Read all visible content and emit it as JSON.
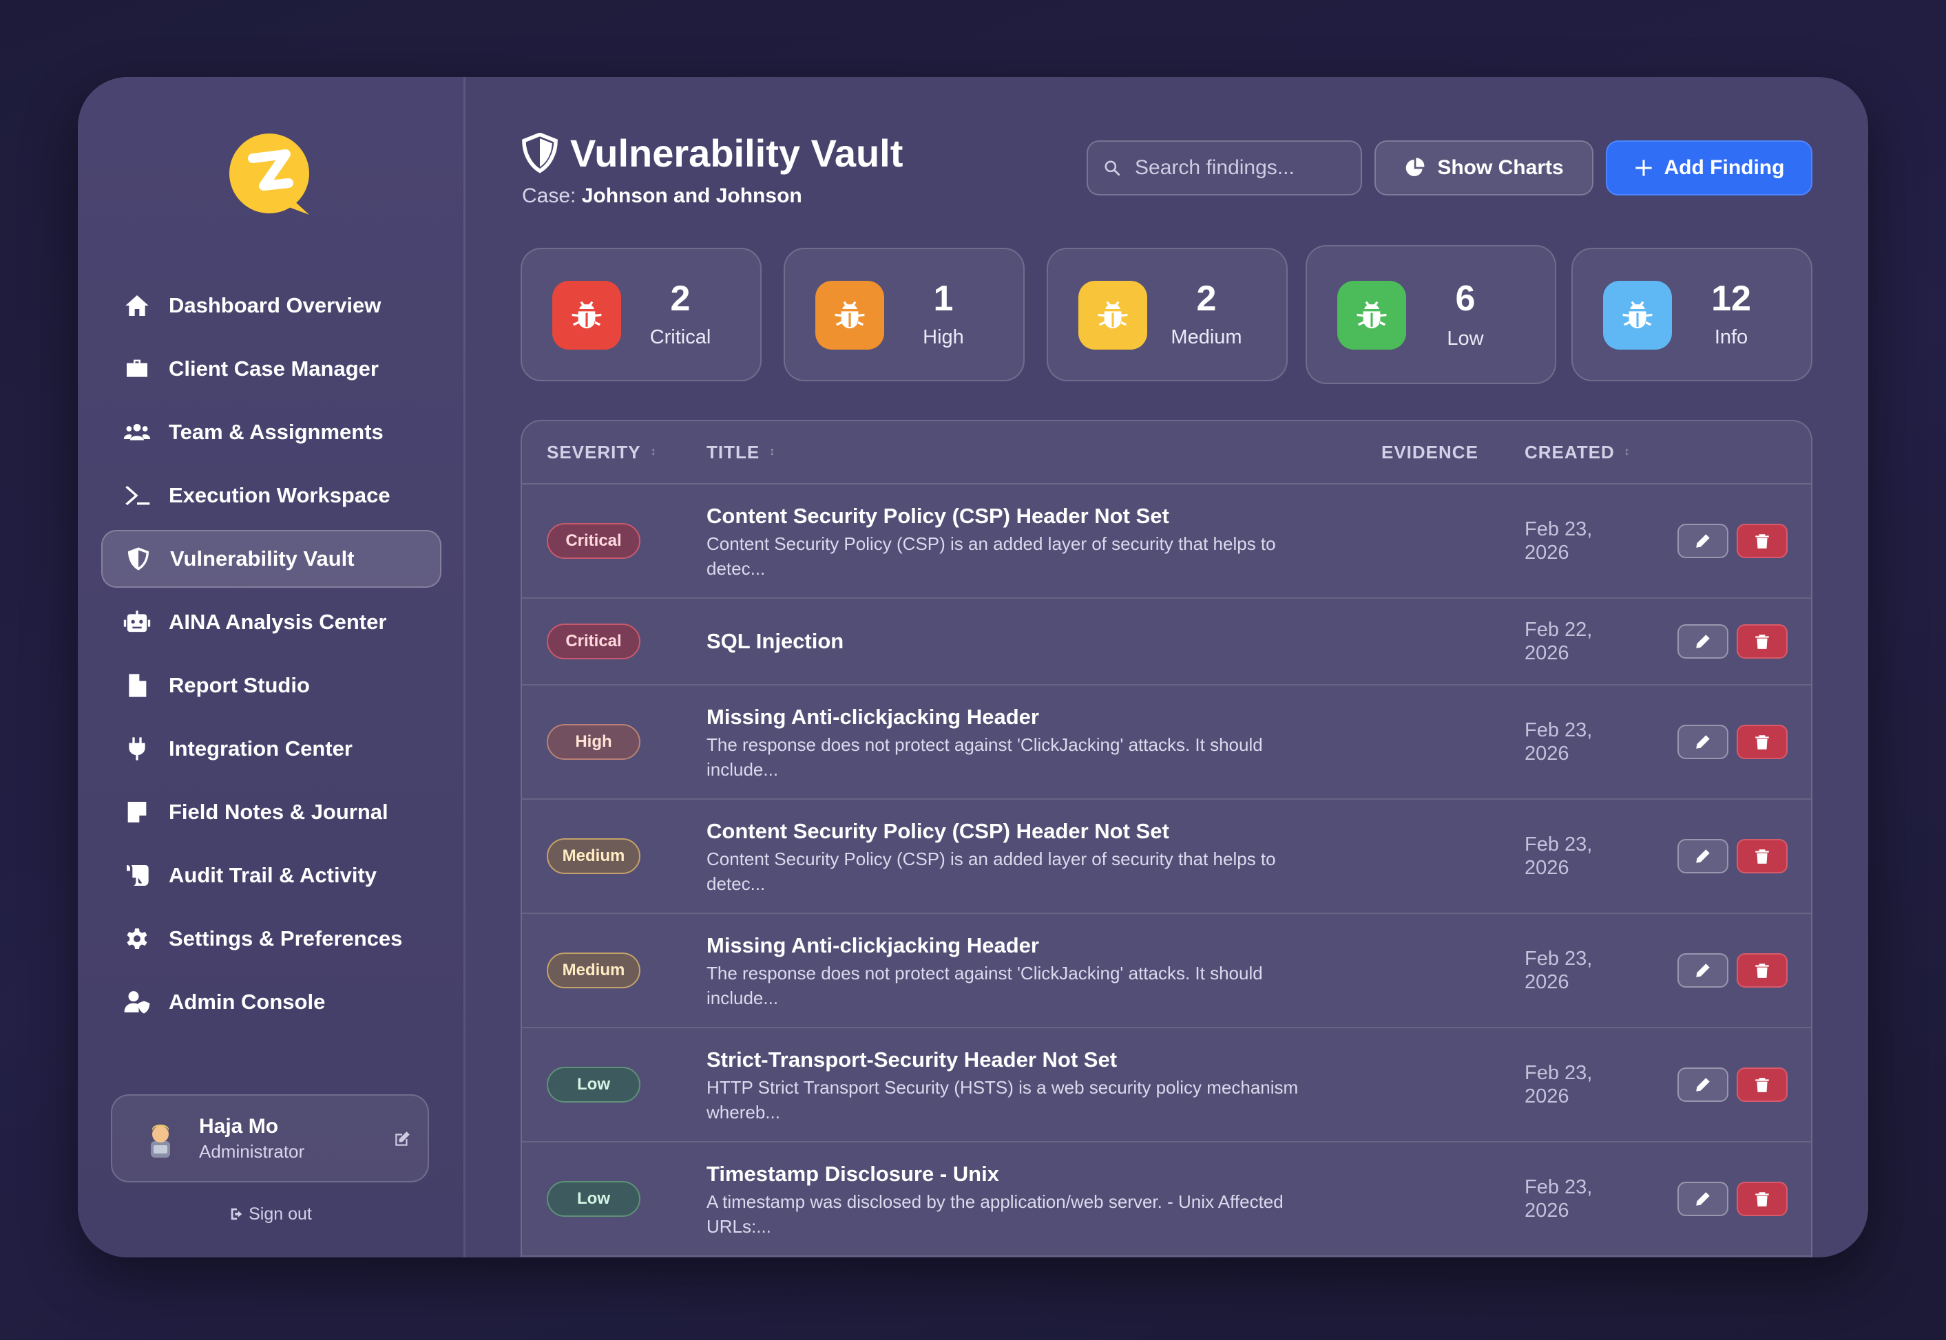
{
  "colors": {
    "accent": "#2f6ef5",
    "critical": "#e8453c",
    "high": "#f0912f",
    "medium": "#f7c43a",
    "low": "#4cbb5a",
    "info": "#5fb8f3",
    "logo": "#fcc934"
  },
  "sidebar": {
    "items": [
      {
        "label": "Dashboard Overview",
        "icon": "home-icon"
      },
      {
        "label": "Client Case Manager",
        "icon": "briefcase-icon"
      },
      {
        "label": "Team & Assignments",
        "icon": "users-icon"
      },
      {
        "label": "Execution Workspace",
        "icon": "terminal-icon"
      },
      {
        "label": "Vulnerability Vault",
        "icon": "shield-icon",
        "active": true
      },
      {
        "label": "AINA Analysis Center",
        "icon": "robot-icon"
      },
      {
        "label": "Report Studio",
        "icon": "file-icon"
      },
      {
        "label": "Integration Center",
        "icon": "plug-icon"
      },
      {
        "label": "Field Notes & Journal",
        "icon": "note-icon"
      },
      {
        "label": "Audit Trail & Activity",
        "icon": "scroll-icon"
      },
      {
        "label": "Settings & Preferences",
        "icon": "gear-icon"
      },
      {
        "label": "Admin Console",
        "icon": "user-shield-icon"
      }
    ],
    "user": {
      "name": "Haja Mo",
      "role": "Administrator"
    },
    "sign_out": "Sign out"
  },
  "header": {
    "title": "Vulnerability Vault",
    "case_prefix": "Case:",
    "case_name": "Johnson and Johnson",
    "search_placeholder": "Search findings...",
    "show_charts": "Show Charts",
    "add_finding": "Add Finding"
  },
  "stats": [
    {
      "count": "2",
      "label": "Critical"
    },
    {
      "count": "1",
      "label": "High"
    },
    {
      "count": "2",
      "label": "Medium"
    },
    {
      "count": "6",
      "label": "Low"
    },
    {
      "count": "12",
      "label": "Info"
    }
  ],
  "table": {
    "columns": {
      "severity": "SEVERITY",
      "title": "TITLE",
      "evidence": "EVIDENCE",
      "created": "CREATED"
    },
    "rows": [
      {
        "severity": "Critical",
        "title": "Content Security Policy (CSP) Header Not Set",
        "desc_1": "Content Security Policy (CSP) is an added layer of security that helps to",
        "desc_2": "detec...",
        "date_1": "Feb 23,",
        "date_2": "2026"
      },
      {
        "severity": "Critical",
        "title": "SQL Injection",
        "desc_1": "",
        "desc_2": "",
        "date_1": "Feb 22,",
        "date_2": "2026"
      },
      {
        "severity": "High",
        "title": "Missing Anti-clickjacking Header",
        "desc_1": "The response does not protect against 'ClickJacking' attacks. It should",
        "desc_2": "include...",
        "date_1": "Feb 23,",
        "date_2": "2026"
      },
      {
        "severity": "Medium",
        "title": "Content Security Policy (CSP) Header Not Set",
        "desc_1": "Content Security Policy (CSP) is an added layer of security that helps to",
        "desc_2": "detec...",
        "date_1": "Feb 23,",
        "date_2": "2026"
      },
      {
        "severity": "Medium",
        "title": "Missing Anti-clickjacking Header",
        "desc_1": "The response does not protect against 'ClickJacking' attacks. It should",
        "desc_2": "include...",
        "date_1": "Feb 23,",
        "date_2": "2026"
      },
      {
        "severity": "Low",
        "title": "Strict-Transport-Security Header Not Set",
        "desc_1": "HTTP Strict Transport Security (HSTS) is a web security policy mechanism",
        "desc_2": "whereb...",
        "date_1": "Feb 23,",
        "date_2": "2026"
      },
      {
        "severity": "Low",
        "title": "Timestamp Disclosure - Unix",
        "desc_1": "A timestamp was disclosed by the application/web server. - Unix Affected",
        "desc_2": "URLs:...",
        "date_1": "Feb 23,",
        "date_2": "2026"
      }
    ]
  }
}
